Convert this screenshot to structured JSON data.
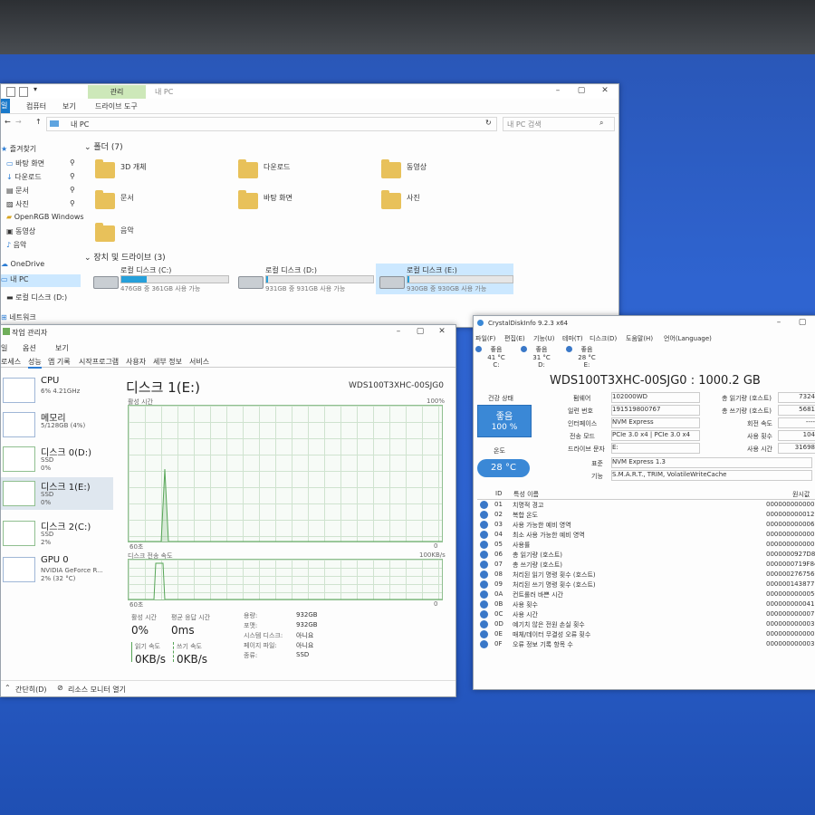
{
  "explorer": {
    "qat_icons": [
      "save-icon",
      "properties-icon",
      "dropdown-icon"
    ],
    "manage_tab": "관리",
    "title": "내 PC",
    "ribbon_tabs": [
      "일",
      "컴퓨터",
      "보기"
    ],
    "drive_tools_tab": "드라이브 도구",
    "address": "내 PC",
    "search_placeholder": "내 PC 검색",
    "nav": [
      {
        "label": "즐겨찾기",
        "icon": "star-icon"
      },
      {
        "label": "바탕 화면",
        "icon": "desktop-icon"
      },
      {
        "label": "다운로드",
        "icon": "download-icon"
      },
      {
        "label": "문서",
        "icon": "document-icon"
      },
      {
        "label": "사진",
        "icon": "picture-icon"
      },
      {
        "label": "OpenRGB Windows",
        "icon": "folder-icon"
      },
      {
        "label": "동영상",
        "icon": "video-icon"
      },
      {
        "label": "음악",
        "icon": "music-icon"
      },
      {
        "label": "OneDrive",
        "icon": "cloud-icon"
      },
      {
        "label": "내 PC",
        "icon": "pc-icon"
      },
      {
        "label": "로컬 디스크 (D:)",
        "icon": "drive-icon"
      },
      {
        "label": "네트워크",
        "icon": "network-icon"
      }
    ],
    "folders_header": "폴더 (7)",
    "folders": [
      "3D 개체",
      "다운로드",
      "동영상",
      "문서",
      "바탕 화면",
      "사진",
      "음악"
    ],
    "drives_header": "장치 및 드라이브 (3)",
    "drives": [
      {
        "name": "로컬 디스크 (C:)",
        "info": "476GB 중 361GB 사용 가능",
        "used": 0.24
      },
      {
        "name": "로컬 디스크 (D:)",
        "info": "931GB 중 931GB 사용 가능",
        "used": 0.01
      },
      {
        "name": "로컬 디스크 (E:)",
        "info": "930GB 중 930GB 사용 가능",
        "used": 0.01
      }
    ]
  },
  "taskmgr": {
    "title": "작업 관리자",
    "menu": [
      "일",
      "옵션",
      "보기"
    ],
    "tabs": [
      "로세스",
      "성능",
      "앱 기록",
      "시작프로그램",
      "사용자",
      "세부 정보",
      "서비스"
    ],
    "side": [
      {
        "name": "CPU",
        "l2": "6% 4.21GHz",
        "l3": ""
      },
      {
        "name": "메모리",
        "l2": "5/128GB (4%)",
        "l3": ""
      },
      {
        "name": "디스크 0(D:)",
        "l2": "SSD",
        "l3": "0%"
      },
      {
        "name": "디스크 1(E:)",
        "l2": "SSD",
        "l3": "0%"
      },
      {
        "name": "디스크 2(C:)",
        "l2": "SSD",
        "l3": "2%"
      },
      {
        "name": "GPU 0",
        "l2": "NVIDIA GeForce R...",
        "l3": "2% (32 °C)"
      }
    ],
    "disk_title": "디스크 1(E:)",
    "model": "WDS100T3XHC-00SJG0",
    "active_time_label": "활성 시간",
    "max_100": "100%",
    "sec_60": "60초",
    "sec_60b": "60초",
    "transfer_label": "디스크 전송 속도",
    "transfer_max": "100KB/s",
    "zero": "0",
    "zero_b": "0",
    "stats": {
      "active_label": "활성 시간",
      "active_val": "0%",
      "resp_label": "평균 응답 시간",
      "resp_val": "0ms",
      "read_label": "읽기 속도",
      "read_val": "0KB/s",
      "write_label": "쓰기 속도",
      "write_val": "0KB/s"
    },
    "props": [
      {
        "k": "용량:",
        "v": "932GB"
      },
      {
        "k": "포맷:",
        "v": "932GB"
      },
      {
        "k": "시스템 디스크:",
        "v": "아니요"
      },
      {
        "k": "페이지 파일:",
        "v": "아니요"
      },
      {
        "k": "종류:",
        "v": "SSD"
      }
    ],
    "footer_brief": "간단히(D)",
    "footer_monitor": "리소스 모니터 열기"
  },
  "cdi": {
    "title": "CrystalDiskInfo 9.2.3 x64",
    "menu": [
      "파일(F)",
      "편집(E)",
      "기능(U)",
      "테마(T)",
      "디스크(D)",
      "도움말(H)",
      "언어(Language)"
    ],
    "drive_tabs": [
      {
        "status": "좋음",
        "temp": "41 °C",
        "letter": "C:"
      },
      {
        "status": "좋음",
        "temp": "31 °C",
        "letter": "D:"
      },
      {
        "status": "좋음",
        "temp": "28 °C",
        "letter": "E:"
      }
    ],
    "disk_name": "WDS100T3XHC-00SJG0 : 1000.2 GB",
    "health_label": "건강 상태",
    "health_status": "좋음",
    "health_pct": "100 %",
    "temp_label": "온도",
    "temp_val": "28 °C",
    "info": [
      {
        "k": "펌웨어",
        "v": "102000WD"
      },
      {
        "k": "일련 번호",
        "v": "191519800767"
      },
      {
        "k": "인터페이스",
        "v": "NVM Express"
      },
      {
        "k": "전송 모드",
        "v": "PCIe 3.0 x4 | PCIe 3.0 x4"
      },
      {
        "k": "드라이브 문자",
        "v": "E:"
      }
    ],
    "std_label": "표준",
    "std_val": "NVM Express 1.3",
    "feat_label": "기능",
    "feat_val": "S.M.A.R.T., TRIM, VolatileWriteCache",
    "right_info": [
      {
        "k": "총 읽기량 (호스트)",
        "v": "7324"
      },
      {
        "k": "총 쓰기량 (호스트)",
        "v": "5681"
      },
      {
        "k": "회전 속도",
        "v": "----"
      },
      {
        "k": "사용 횟수",
        "v": "104"
      },
      {
        "k": "사용 시간",
        "v": "31698"
      }
    ],
    "col_id": "ID",
    "col_name": "특성 이름",
    "col_raw": "원시값",
    "attrs": [
      {
        "id": "01",
        "name": "치명적 경고",
        "raw": "0000000000000"
      },
      {
        "id": "02",
        "name": "복합 온도",
        "raw": "000000000012"
      },
      {
        "id": "03",
        "name": "사용 가능한 예비 영역",
        "raw": "000000000006"
      },
      {
        "id": "04",
        "name": "최소 사용 가능한 예비 영역",
        "raw": "000000000000"
      },
      {
        "id": "05",
        "name": "사용률",
        "raw": "0000000000000"
      },
      {
        "id": "06",
        "name": "총 읽기량 (호스트)",
        "raw": "0000000927D84"
      },
      {
        "id": "07",
        "name": "총 쓰기량 (호스트)",
        "raw": "0000000719F84"
      },
      {
        "id": "08",
        "name": "처리된 읽기 명령 횟수 (호스트)",
        "raw": "000000276756C"
      },
      {
        "id": "09",
        "name": "처리된 쓰기 명령 횟수 (호스트)",
        "raw": "000000143877F"
      },
      {
        "id": "0A",
        "name": "컨트롤러 바쁜 시간",
        "raw": "000000000005C"
      },
      {
        "id": "0B",
        "name": "사용 횟수",
        "raw": "000000000041"
      },
      {
        "id": "0C",
        "name": "사용 시간",
        "raw": "0000000000078D"
      },
      {
        "id": "0D",
        "name": "예기치 않은 전원 손실 횟수",
        "raw": "000000000003"
      },
      {
        "id": "0E",
        "name": "매체/데이터 무결성 오류 횟수",
        "raw": "000000000000"
      },
      {
        "id": "0F",
        "name": "오류 정보 기록 항목 수",
        "raw": "000000000003"
      }
    ]
  },
  "colors": {
    "accent": "#26a0da",
    "good": "#3a88d6",
    "manage": "#cde8b9",
    "graph": "#56a556"
  }
}
